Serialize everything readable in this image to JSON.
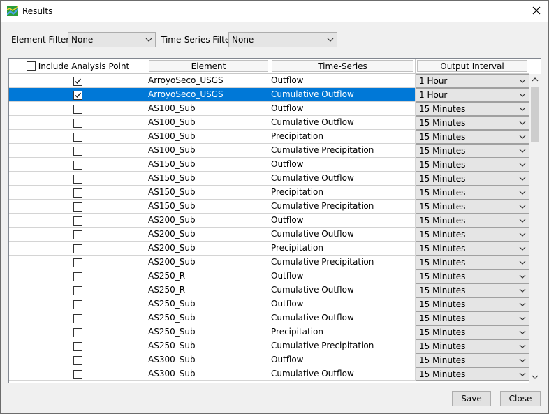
{
  "window": {
    "title": "Results"
  },
  "filters": {
    "element_label": "Element Filter",
    "element_value": "None",
    "timeseries_label": "Time-Series Filter",
    "timeseries_value": "None"
  },
  "table": {
    "headers": {
      "include": "Include Analysis Point",
      "element": "Element",
      "timeseries": "Time-Series",
      "interval": "Output Interval"
    },
    "rows": [
      {
        "checked": true,
        "element": "ArroyoSeco_USGS",
        "timeseries": "Outflow",
        "interval": "1 Hour"
      },
      {
        "checked": true,
        "element": "ArroyoSeco_USGS",
        "timeseries": "Cumulative Outflow",
        "interval": "1 Hour",
        "selected": true
      },
      {
        "checked": false,
        "element": "AS100_Sub",
        "timeseries": "Outflow",
        "interval": "15 Minutes"
      },
      {
        "checked": false,
        "element": "AS100_Sub",
        "timeseries": "Cumulative Outflow",
        "interval": "15 Minutes"
      },
      {
        "checked": false,
        "element": "AS100_Sub",
        "timeseries": "Precipitation",
        "interval": "15 Minutes"
      },
      {
        "checked": false,
        "element": "AS100_Sub",
        "timeseries": "Cumulative Precipitation",
        "interval": "15 Minutes"
      },
      {
        "checked": false,
        "element": "AS150_Sub",
        "timeseries": "Outflow",
        "interval": "15 Minutes"
      },
      {
        "checked": false,
        "element": "AS150_Sub",
        "timeseries": "Cumulative Outflow",
        "interval": "15 Minutes"
      },
      {
        "checked": false,
        "element": "AS150_Sub",
        "timeseries": "Precipitation",
        "interval": "15 Minutes"
      },
      {
        "checked": false,
        "element": "AS150_Sub",
        "timeseries": "Cumulative Precipitation",
        "interval": "15 Minutes"
      },
      {
        "checked": false,
        "element": "AS200_Sub",
        "timeseries": "Outflow",
        "interval": "15 Minutes"
      },
      {
        "checked": false,
        "element": "AS200_Sub",
        "timeseries": "Cumulative Outflow",
        "interval": "15 Minutes"
      },
      {
        "checked": false,
        "element": "AS200_Sub",
        "timeseries": "Precipitation",
        "interval": "15 Minutes"
      },
      {
        "checked": false,
        "element": "AS200_Sub",
        "timeseries": "Cumulative Precipitation",
        "interval": "15 Minutes"
      },
      {
        "checked": false,
        "element": "AS250_R",
        "timeseries": "Outflow",
        "interval": "15 Minutes"
      },
      {
        "checked": false,
        "element": "AS250_R",
        "timeseries": "Cumulative Outflow",
        "interval": "15 Minutes"
      },
      {
        "checked": false,
        "element": "AS250_Sub",
        "timeseries": "Outflow",
        "interval": "15 Minutes"
      },
      {
        "checked": false,
        "element": "AS250_Sub",
        "timeseries": "Cumulative Outflow",
        "interval": "15 Minutes"
      },
      {
        "checked": false,
        "element": "AS250_Sub",
        "timeseries": "Precipitation",
        "interval": "15 Minutes"
      },
      {
        "checked": false,
        "element": "AS250_Sub",
        "timeseries": "Cumulative Precipitation",
        "interval": "15 Minutes"
      },
      {
        "checked": false,
        "element": "AS300_Sub",
        "timeseries": "Outflow",
        "interval": "15 Minutes"
      },
      {
        "checked": false,
        "element": "AS300_Sub",
        "timeseries": "Cumulative Outflow",
        "interval": "15 Minutes"
      }
    ]
  },
  "buttons": {
    "save": "Save",
    "close": "Close"
  },
  "colors": {
    "selection": "#0078d7",
    "combo_bg": "#e5e5e5"
  }
}
